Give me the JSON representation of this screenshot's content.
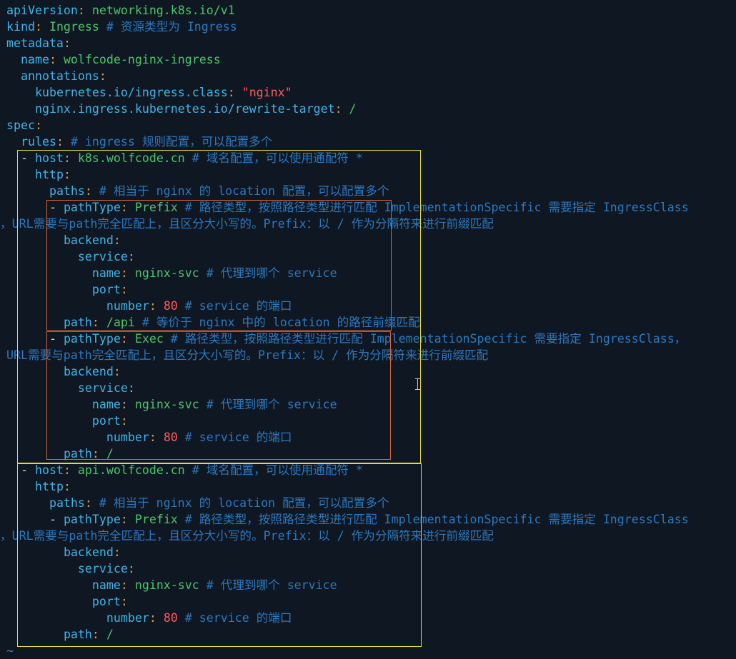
{
  "editor": {
    "lines": [
      {
        "segs": [
          {
            "t": "apiVersion",
            "c": "key"
          },
          {
            "t": ": ",
            "c": "colon"
          },
          {
            "t": "networking.k8s.io/v1",
            "c": "str"
          }
        ]
      },
      {
        "segs": [
          {
            "t": "kind",
            "c": "key"
          },
          {
            "t": ": ",
            "c": "colon"
          },
          {
            "t": "Ingress",
            "c": "str"
          },
          {
            "t": " # 资源类型为 Ingress",
            "c": "comment"
          }
        ]
      },
      {
        "segs": [
          {
            "t": "metadata",
            "c": "key"
          },
          {
            "t": ":",
            "c": "colon"
          }
        ]
      },
      {
        "segs": [
          {
            "t": "  "
          },
          {
            "t": "name",
            "c": "key"
          },
          {
            "t": ": ",
            "c": "colon"
          },
          {
            "t": "wolfcode-nginx-ingress",
            "c": "str"
          }
        ]
      },
      {
        "segs": [
          {
            "t": "  "
          },
          {
            "t": "annotations",
            "c": "key"
          },
          {
            "t": ":",
            "c": "colon"
          }
        ]
      },
      {
        "segs": [
          {
            "t": "    "
          },
          {
            "t": "kubernetes.io/ingress.class",
            "c": "key"
          },
          {
            "t": ": ",
            "c": "colon"
          },
          {
            "t": "\"nginx\"",
            "c": "qstr"
          }
        ]
      },
      {
        "segs": [
          {
            "t": "    "
          },
          {
            "t": "nginx.ingress.kubernetes.io/rewrite-target",
            "c": "key"
          },
          {
            "t": ": ",
            "c": "colon"
          },
          {
            "t": "/",
            "c": "str"
          }
        ]
      },
      {
        "segs": [
          {
            "t": "spec",
            "c": "key"
          },
          {
            "t": ":",
            "c": "colon"
          }
        ]
      },
      {
        "segs": [
          {
            "t": "  "
          },
          {
            "t": "rules",
            "c": "key"
          },
          {
            "t": ":",
            "c": "colon"
          },
          {
            "t": " # ingress 规则配置，可以配置多个",
            "c": "comment"
          }
        ]
      },
      {
        "segs": [
          {
            "t": "  "
          },
          {
            "t": "- ",
            "c": "dash"
          },
          {
            "t": "host",
            "c": "key"
          },
          {
            "t": ": ",
            "c": "colon"
          },
          {
            "t": "k8s.wolfcode.cn",
            "c": "str"
          },
          {
            "t": " # 域名配置，可以使用通配符 *",
            "c": "comment"
          }
        ]
      },
      {
        "segs": [
          {
            "t": "    "
          },
          {
            "t": "http",
            "c": "key"
          },
          {
            "t": ":",
            "c": "colon"
          }
        ]
      },
      {
        "segs": [
          {
            "t": "      "
          },
          {
            "t": "paths",
            "c": "key"
          },
          {
            "t": ":",
            "c": "colon"
          },
          {
            "t": " # 相当于 nginx 的 location 配置，可以配置多个",
            "c": "comment"
          }
        ]
      },
      {
        "segs": [
          {
            "t": "      "
          },
          {
            "t": "- ",
            "c": "dash"
          },
          {
            "t": "pathType",
            "c": "key"
          },
          {
            "t": ": ",
            "c": "colon"
          },
          {
            "t": "Prefix",
            "c": "str"
          },
          {
            "t": " # 路径类型，按照路径类型进行匹配 ImplementationSpecific 需要指定 IngressClass",
            "c": "comment"
          }
        ]
      },
      {
        "x": 0,
        "segs": [
          {
            "t": "，URL需要与path完全匹配上，且区分大小写的。Prefix：以 / 作为分隔符来进行前缀匹配",
            "c": "comment"
          }
        ]
      },
      {
        "segs": [
          {
            "t": "        "
          },
          {
            "t": "backend",
            "c": "key"
          },
          {
            "t": ":",
            "c": "colon"
          }
        ]
      },
      {
        "segs": [
          {
            "t": "          "
          },
          {
            "t": "service",
            "c": "key"
          },
          {
            "t": ":",
            "c": "colon"
          }
        ]
      },
      {
        "segs": [
          {
            "t": "            "
          },
          {
            "t": "name",
            "c": "key"
          },
          {
            "t": ": ",
            "c": "colon"
          },
          {
            "t": "nginx-svc",
            "c": "str"
          },
          {
            "t": " # 代理到哪个 service",
            "c": "comment"
          }
        ]
      },
      {
        "segs": [
          {
            "t": "            "
          },
          {
            "t": "port",
            "c": "key"
          },
          {
            "t": ":",
            "c": "colon"
          }
        ]
      },
      {
        "segs": [
          {
            "t": "              "
          },
          {
            "t": "number",
            "c": "key"
          },
          {
            "t": ": ",
            "c": "colon"
          },
          {
            "t": "80",
            "c": "num"
          },
          {
            "t": " # service 的端口",
            "c": "comment"
          }
        ]
      },
      {
        "segs": [
          {
            "t": "        "
          },
          {
            "t": "path",
            "c": "key"
          },
          {
            "t": ": ",
            "c": "colon"
          },
          {
            "t": "/api",
            "c": "str"
          },
          {
            "t": " # 等价于 nginx 中的 location 的路径前缀匹配",
            "c": "comment"
          }
        ]
      },
      {
        "segs": [
          {
            "t": "      "
          },
          {
            "t": "- ",
            "c": "dash"
          },
          {
            "t": "pathType",
            "c": "key"
          },
          {
            "t": ": ",
            "c": "colon"
          },
          {
            "t": "Exec",
            "c": "str"
          },
          {
            "t": " # 路径类型，按照路径类型进行匹配 ImplementationSpecific 需要指定 IngressClass，",
            "c": "comment"
          }
        ]
      },
      {
        "segs": [
          {
            "t": "URL需要与path完全匹配上，且区分大小写的。Prefix：以 / 作为分隔符来进行前缀匹配",
            "c": "comment"
          }
        ]
      },
      {
        "segs": [
          {
            "t": "        "
          },
          {
            "t": "backend",
            "c": "key"
          },
          {
            "t": ":",
            "c": "colon"
          }
        ]
      },
      {
        "segs": [
          {
            "t": "          "
          },
          {
            "t": "service",
            "c": "key"
          },
          {
            "t": ":",
            "c": "colon"
          }
        ]
      },
      {
        "segs": [
          {
            "t": "            "
          },
          {
            "t": "name",
            "c": "key"
          },
          {
            "t": ": ",
            "c": "colon"
          },
          {
            "t": "nginx-svc",
            "c": "str"
          },
          {
            "t": " # 代理到哪个 service",
            "c": "comment"
          }
        ]
      },
      {
        "segs": [
          {
            "t": "            "
          },
          {
            "t": "port",
            "c": "key"
          },
          {
            "t": ":",
            "c": "colon"
          }
        ]
      },
      {
        "segs": [
          {
            "t": "              "
          },
          {
            "t": "number",
            "c": "key"
          },
          {
            "t": ": ",
            "c": "colon"
          },
          {
            "t": "80",
            "c": "num"
          },
          {
            "t": " # service 的端口",
            "c": "comment"
          }
        ]
      },
      {
        "segs": [
          {
            "t": "        "
          },
          {
            "t": "path",
            "c": "key"
          },
          {
            "t": ": ",
            "c": "colon"
          },
          {
            "t": "/",
            "c": "str"
          }
        ]
      },
      {
        "segs": [
          {
            "t": "  "
          },
          {
            "t": "- ",
            "c": "dash"
          },
          {
            "t": "host",
            "c": "key"
          },
          {
            "t": ": ",
            "c": "colon"
          },
          {
            "t": "api.wolfcode.cn",
            "c": "str"
          },
          {
            "t": " # 域名配置，可以使用通配符 *",
            "c": "comment"
          }
        ]
      },
      {
        "segs": [
          {
            "t": "    "
          },
          {
            "t": "http",
            "c": "key"
          },
          {
            "t": ":",
            "c": "colon"
          }
        ]
      },
      {
        "segs": [
          {
            "t": "      "
          },
          {
            "t": "paths",
            "c": "key"
          },
          {
            "t": ":",
            "c": "colon"
          },
          {
            "t": " # 相当于 nginx 的 location 配置，可以配置多个",
            "c": "comment"
          }
        ]
      },
      {
        "segs": [
          {
            "t": "      "
          },
          {
            "t": "- ",
            "c": "dash"
          },
          {
            "t": "pathType",
            "c": "key"
          },
          {
            "t": ": ",
            "c": "colon"
          },
          {
            "t": "Prefix",
            "c": "str"
          },
          {
            "t": " # 路径类型，按照路径类型进行匹配 ImplementationSpecific 需要指定 IngressClass",
            "c": "comment"
          }
        ]
      },
      {
        "x": 0,
        "segs": [
          {
            "t": "，URL需要与path完全匹配上，且区分大小写的。Prefix：以 / 作为分隔符来进行前缀匹配",
            "c": "comment"
          }
        ]
      },
      {
        "segs": [
          {
            "t": "        "
          },
          {
            "t": "backend",
            "c": "key"
          },
          {
            "t": ":",
            "c": "colon"
          }
        ]
      },
      {
        "segs": [
          {
            "t": "          "
          },
          {
            "t": "service",
            "c": "key"
          },
          {
            "t": ":",
            "c": "colon"
          }
        ]
      },
      {
        "segs": [
          {
            "t": "            "
          },
          {
            "t": "name",
            "c": "key"
          },
          {
            "t": ": ",
            "c": "colon"
          },
          {
            "t": "nginx-svc",
            "c": "str"
          },
          {
            "t": " # 代理到哪个 service",
            "c": "comment"
          }
        ]
      },
      {
        "segs": [
          {
            "t": "            "
          },
          {
            "t": "port",
            "c": "key"
          },
          {
            "t": ":",
            "c": "colon"
          }
        ]
      },
      {
        "segs": [
          {
            "t": "              "
          },
          {
            "t": "number",
            "c": "key"
          },
          {
            "t": ": ",
            "c": "colon"
          },
          {
            "t": "80",
            "c": "num"
          },
          {
            "t": " # service 的端口",
            "c": "comment"
          }
        ]
      },
      {
        "segs": [
          {
            "t": "        "
          },
          {
            "t": "path",
            "c": "key"
          },
          {
            "t": ": ",
            "c": "colon"
          },
          {
            "t": "/",
            "c": "str"
          }
        ]
      },
      {
        "segs": [
          {
            "t": "~",
            "c": "tilde"
          }
        ]
      }
    ]
  },
  "colors": {
    "background": "#0f1722",
    "key": "#41b3e8",
    "colon": "#e0a34d",
    "string": "#4ec46b",
    "number": "#ff5b5b",
    "comment": "#2c79c0",
    "host_box": "#e5dc3a",
    "path_box": "#d2653d"
  }
}
